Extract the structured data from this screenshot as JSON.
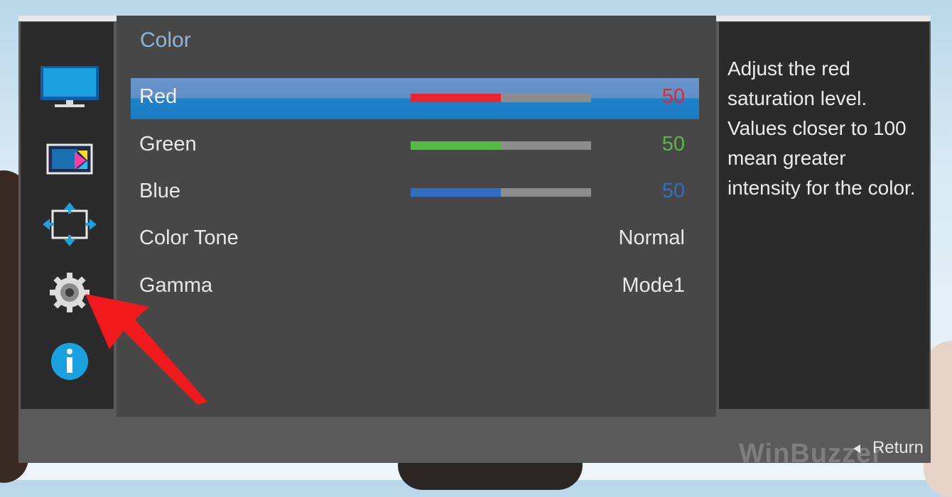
{
  "osd": {
    "title": "Color",
    "items": [
      {
        "label": "Red",
        "value": "50",
        "level": 0.5,
        "color": "#e8252f",
        "selected": true
      },
      {
        "label": "Green",
        "value": "50",
        "level": 0.5,
        "color": "#58b847",
        "selected": false
      },
      {
        "label": "Blue",
        "value": "50",
        "level": 0.5,
        "color": "#2f6ec0",
        "selected": false
      },
      {
        "label": "Color Tone",
        "value": "Normal"
      },
      {
        "label": "Gamma",
        "value": "Mode1"
      }
    ],
    "help_text": "Adjust the red saturation level. Values closer to 100 mean greater intensity for the color.",
    "footer": {
      "return_label": "Return"
    }
  },
  "sidebar": {
    "icons": [
      "monitor-icon",
      "picture-icon",
      "position-icon",
      "settings-gear-icon",
      "info-icon"
    ],
    "accent": "#1aa2e0"
  },
  "watermark": {
    "text": "WinBuzzer"
  },
  "annotation": {
    "color": "#f0191b"
  }
}
